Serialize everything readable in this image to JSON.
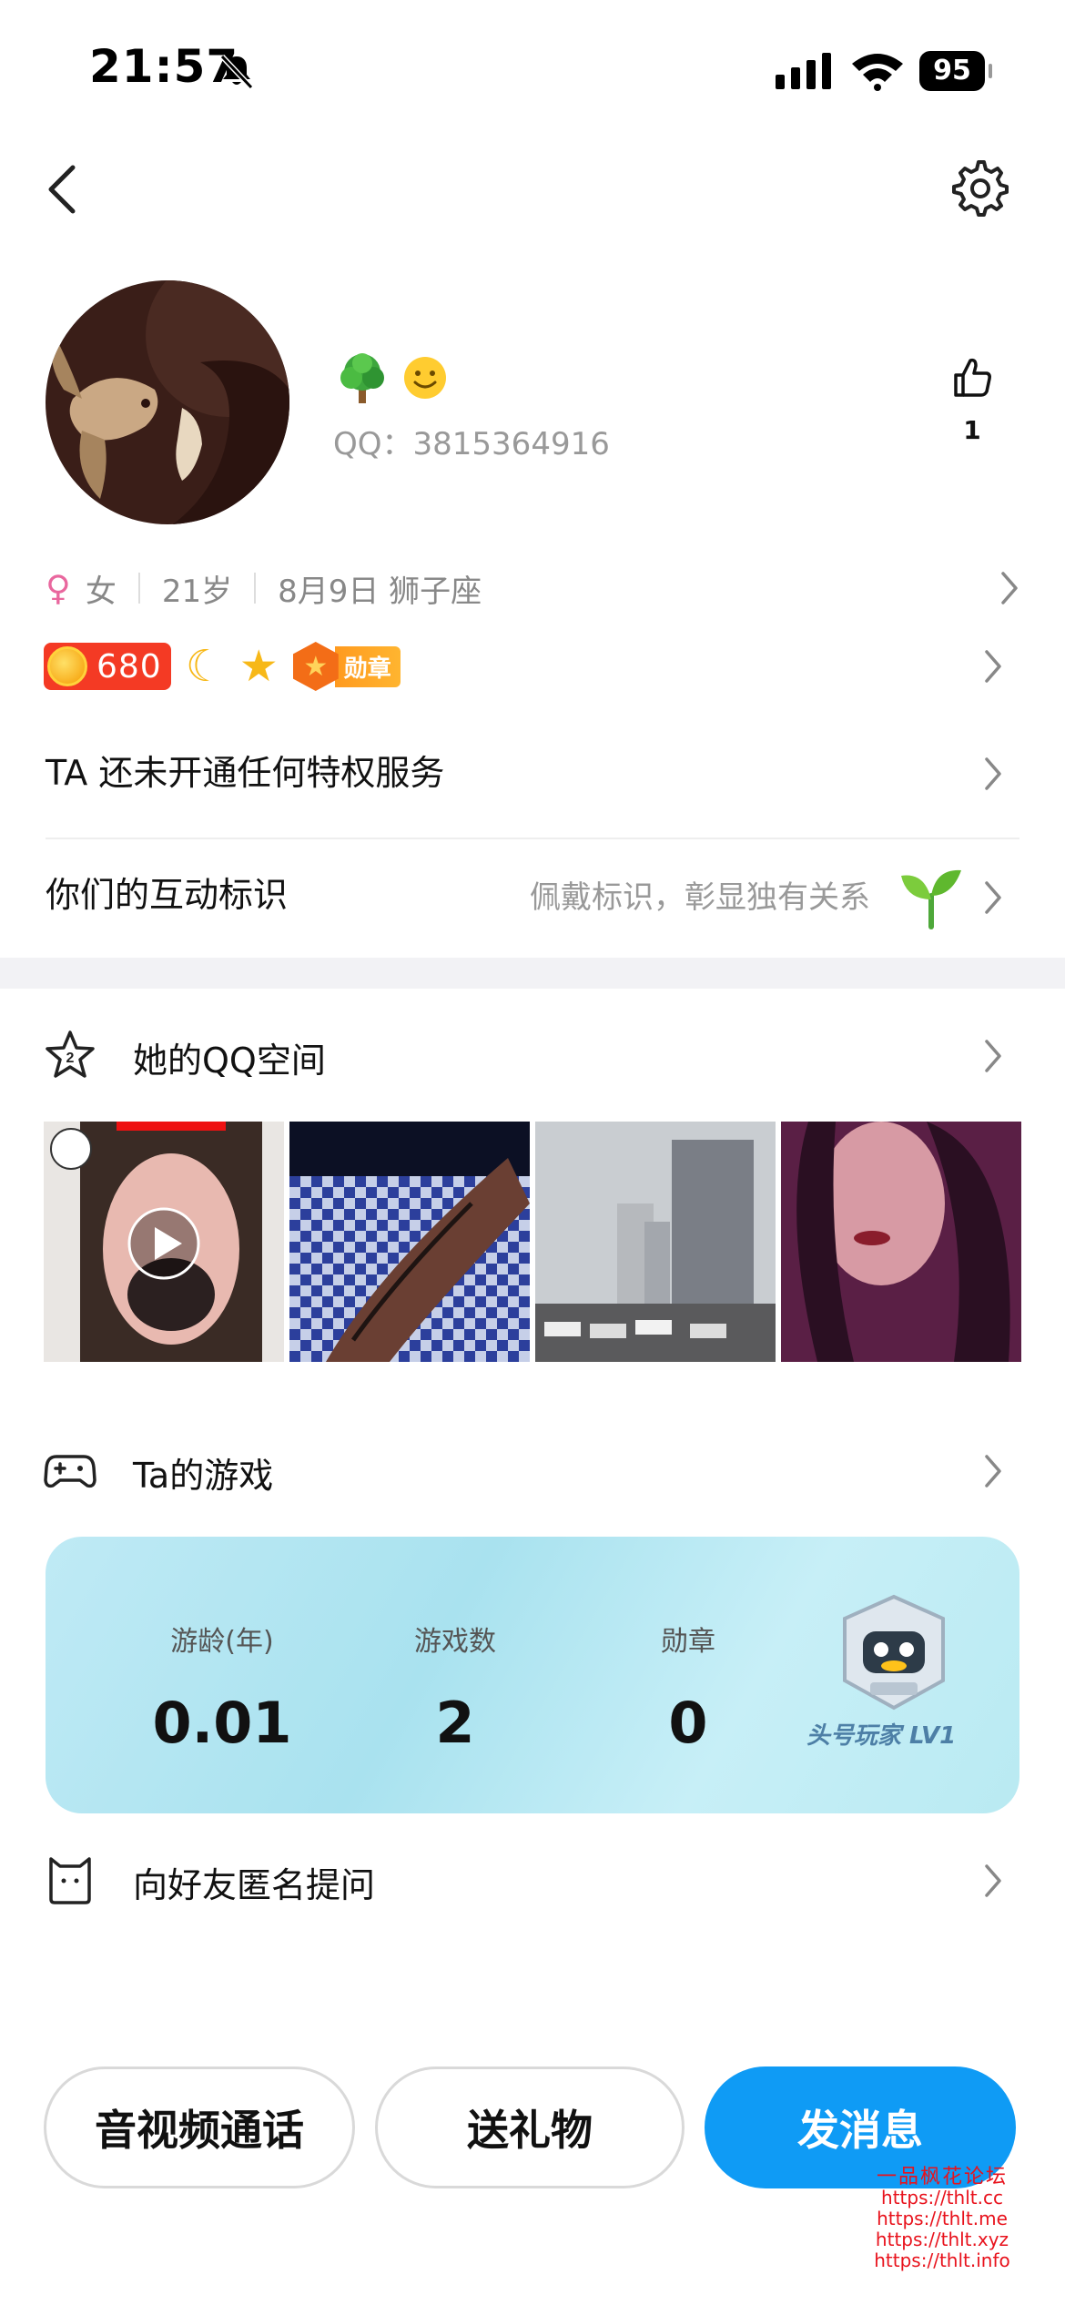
{
  "status_bar": {
    "time": "21:57",
    "battery": "95"
  },
  "profile": {
    "qq_label": "QQ：3815364916",
    "like_count": "1",
    "gender": "女",
    "age": "21岁",
    "birthday": "8月9日 狮子座",
    "coin_value": "680",
    "medal_label": "勋章"
  },
  "rows": {
    "privilege": "TA 还未开通任何特权服务",
    "interaction": "你们的互动标识",
    "interaction_hint": "佩戴标识，彰显独有关系"
  },
  "qzone": {
    "title": "她的QQ空间"
  },
  "games": {
    "title": "Ta的游戏",
    "stats": [
      {
        "label": "游龄(年)",
        "value": "0.01"
      },
      {
        "label": "游戏数",
        "value": "2"
      },
      {
        "label": "勋章",
        "value": "0"
      }
    ],
    "level_label": "头号玩家 LV1"
  },
  "ask": {
    "title": "向好友匿名提问"
  },
  "actions": {
    "call": "音视频通话",
    "gift": "送礼物",
    "message": "发消息"
  },
  "watermark": {
    "title": "一品枫花论坛",
    "lines": [
      "https://thlt.cc",
      "https://thlt.me",
      "https://thlt.xyz",
      "https://thlt.info"
    ]
  }
}
